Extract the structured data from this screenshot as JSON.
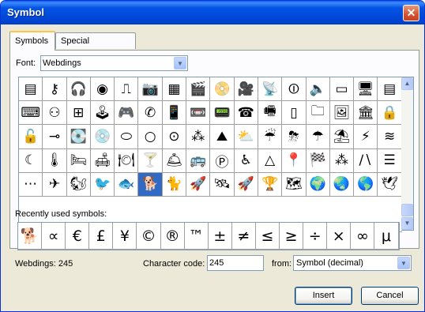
{
  "window": {
    "title": "Symbol",
    "close_glyph": "✕"
  },
  "tabs": [
    {
      "label": "Symbols",
      "active": true
    },
    {
      "label": "Special Characters",
      "active": false
    }
  ],
  "font": {
    "label": "Font:",
    "value": "Webdings"
  },
  "symbol_grid": {
    "selected_index": 69,
    "rows": [
      [
        "▤",
        "⚷",
        "🎧",
        "◉",
        "⎍",
        "📷",
        "▦",
        "🎬",
        "📀",
        "🎥",
        "📡",
        "⏼",
        "🔈",
        "▭",
        "🖥",
        "▤"
      ],
      [
        "⌨",
        "⚇",
        "⊞",
        "🕹",
        "🎮",
        "✆",
        "📱",
        "📼",
        "📟",
        "☎",
        "🖷",
        "▯",
        "🗀",
        "🖼",
        "🏛",
        "🔒"
      ],
      [
        "🔓",
        "⊸",
        "💽",
        "💿",
        "⬭",
        "○",
        "⊙",
        "⁂",
        "⛰",
        "⛅",
        "☔",
        "⛈",
        "☂",
        "⛱",
        "⚡",
        "≋"
      ],
      [
        "☾",
        "🌡",
        "🛏",
        "🛋",
        "🍽",
        "🍸",
        "🛎",
        "🚌",
        "Ⓟ",
        "♿",
        "△",
        "📍",
        "🏁",
        "⁂",
        "∕∖",
        "☰"
      ],
      [
        "⋯",
        "✈",
        "🐿",
        "🐦",
        "🐟",
        "🐕",
        "🐈",
        "🚀",
        "🛰",
        "🚀",
        "🏆",
        "🗺",
        "🌍",
        "🌏",
        "🌎",
        "🕊"
      ]
    ]
  },
  "recent": {
    "label": "Recently used symbols:",
    "items": [
      "🐕",
      "∝",
      "€",
      "£",
      "¥",
      "©",
      "®",
      "™",
      "±",
      "≠",
      "≤",
      "≥",
      "÷",
      "×",
      "∞",
      "μ"
    ]
  },
  "status": {
    "font_char": "Webdings: 245",
    "code_label": "Character code:",
    "code_value": "245",
    "from_label": "from:",
    "from_value": "Symbol (decimal)"
  },
  "buttons": {
    "insert": "Insert",
    "cancel": "Cancel"
  },
  "colors": {
    "title_blue": "#0054e3",
    "selection": "#316ac5",
    "dialog_bg": "#ece9d8"
  }
}
